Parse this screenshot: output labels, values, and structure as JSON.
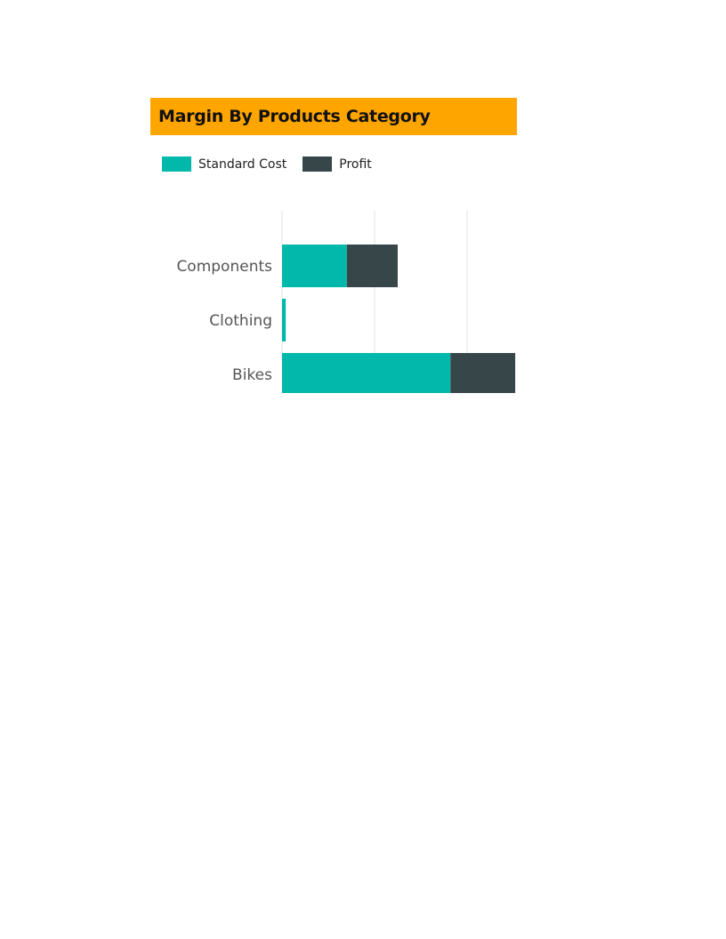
{
  "chart_data": {
    "type": "bar",
    "orientation": "horizontal",
    "stacked": true,
    "title": "Margin By Products Category",
    "title_background": "#ffa500",
    "categories": [
      "Components",
      "Clothing",
      "Bikes"
    ],
    "series": [
      {
        "name": "Standard Cost",
        "color": "#01b8aa",
        "values": [
          0.7,
          0.04,
          1.82
        ]
      },
      {
        "name": "Profit",
        "color": "#374649",
        "values": [
          0.55,
          0.0,
          0.7
        ]
      }
    ],
    "xlim": [
      0,
      2.52
    ],
    "gridlines": [
      0,
      1,
      2
    ],
    "grid": true,
    "legend_position": "top-left",
    "xlabel": "",
    "ylabel": ""
  }
}
